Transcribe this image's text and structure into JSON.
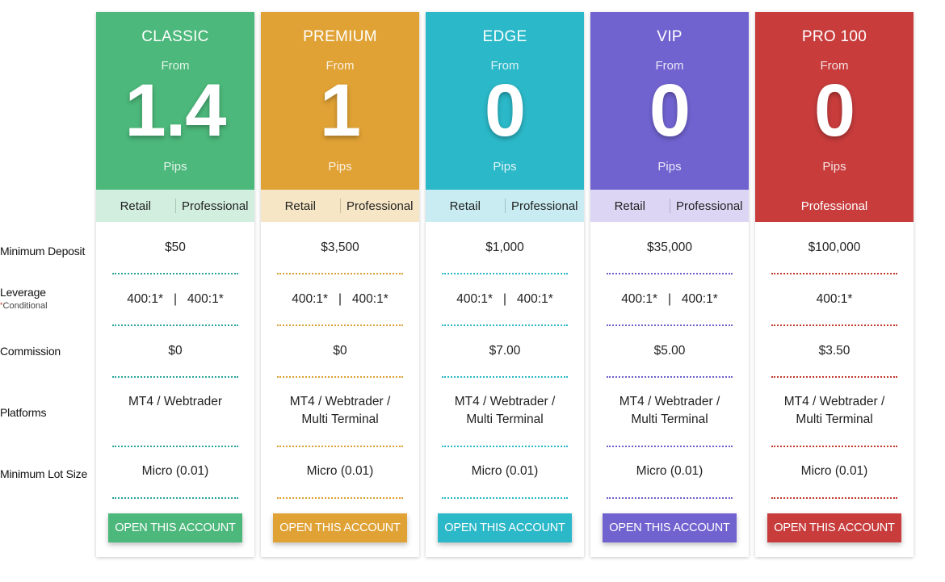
{
  "row_labels": {
    "min_deposit": "Minimum Deposit",
    "leverage": "Leverage",
    "leverage_note_star": "*",
    "leverage_note": "Conditional",
    "commission": "Commission",
    "platforms": "Platforms",
    "min_lot": "Minimum Lot Size"
  },
  "plans": [
    {
      "name": "CLASSIC",
      "from": "From",
      "spread": "1.4",
      "unit": "Pips",
      "type_retail": "Retail",
      "type_pro": "Professional",
      "deposit": "$50",
      "leverage": "400:1*   |   400:1*",
      "commission": "$0",
      "platforms": "MT4 / Webtrader",
      "lot": "Micro (0.01)",
      "button": "OPEN THIS ACCOUNT",
      "color": "#4cb87b",
      "tint": "#d1eedf",
      "dot": "#2aa39a"
    },
    {
      "name": "PREMIUM",
      "from": "From",
      "spread": "1",
      "unit": "Pips",
      "type_retail": "Retail",
      "type_pro": "Professional",
      "deposit": "$3,500",
      "leverage": "400:1*   |   400:1*",
      "commission": "$0",
      "platforms": "MT4 / Webtrader / Multi Terminal",
      "lot": "Micro (0.01)",
      "button": "OPEN THIS ACCOUNT",
      "color": "#e0a235",
      "tint": "#f7e6c5",
      "dot": "#dba033"
    },
    {
      "name": "EDGE",
      "from": "From",
      "spread": "0",
      "unit": "Pips",
      "type_retail": "Retail",
      "type_pro": "Professional",
      "deposit": "$1,000",
      "leverage": "400:1*   |   400:1*",
      "commission": "$7.00",
      "platforms": "MT4 / Webtrader / Multi Terminal",
      "lot": "Micro (0.01)",
      "button": "OPEN THIS ACCOUNT",
      "color": "#2bb8c8",
      "tint": "#c8ecf1",
      "dot": "#2bb8c8"
    },
    {
      "name": "VIP",
      "from": "From",
      "spread": "0",
      "unit": "Pips",
      "type_retail": "Retail",
      "type_pro": "Professional",
      "deposit": "$35,000",
      "leverage": "400:1*   |   400:1*",
      "commission": "$5.00",
      "platforms": "MT4 / Webtrader / Multi Terminal",
      "lot": "Micro (0.01)",
      "button": "OPEN THIS ACCOUNT",
      "color": "#7063d0",
      "tint": "#dcd6f4",
      "dot": "#6a5fcb"
    },
    {
      "name": "PRO 100",
      "from": "From",
      "spread": "0",
      "unit": "Pips",
      "type_retail": "",
      "type_pro": "Professional",
      "deposit": "$100,000",
      "leverage": "400:1*",
      "commission": "$3.50",
      "platforms": "MT4 / Webtrader / Multi Terminal",
      "lot": "Micro (0.01)",
      "button": "OPEN THIS ACCOUNT",
      "color": "#c83c3c",
      "tint": "#c83c3c",
      "dot": "#c0392b"
    }
  ]
}
